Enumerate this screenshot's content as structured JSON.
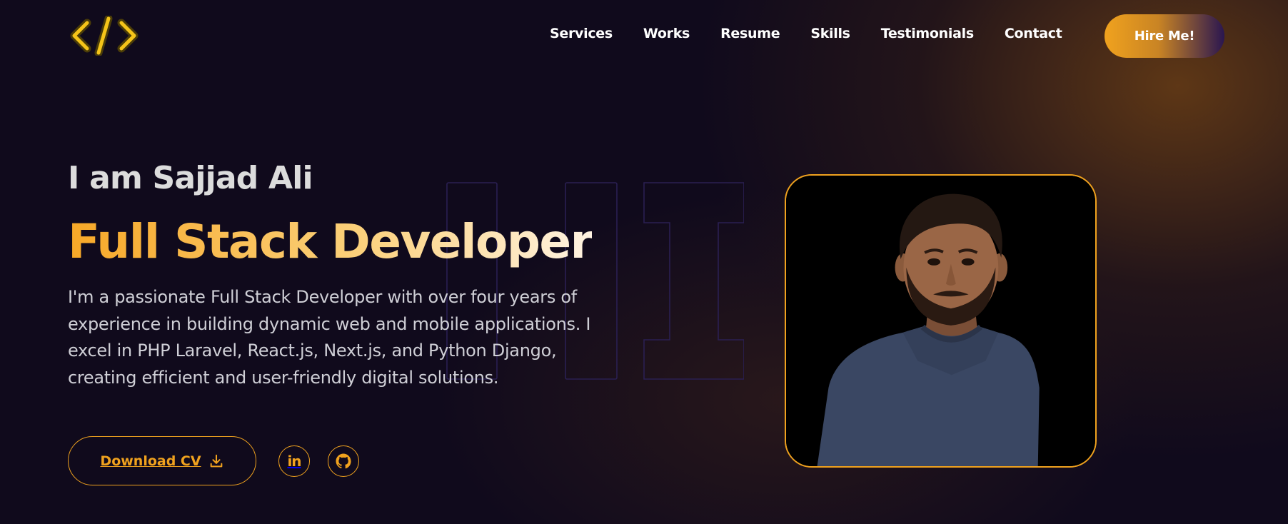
{
  "header": {
    "logo_icon": "code-brackets-icon",
    "nav": [
      "Services",
      "Works",
      "Resume",
      "Skills",
      "Testimonials",
      "Contact"
    ],
    "hire_label": "Hire Me!"
  },
  "hero": {
    "greeting": "I am Sajjad Ali",
    "role": "Full Stack Developer",
    "bio": "I'm a passionate Full Stack Developer with over four years of experience in building dynamic web and mobile applications. I excel in PHP Laravel, React.js, Next.js, and Python Django, creating efficient and user-friendly digital solutions.",
    "download_label": "Download CV",
    "download_icon": "download-icon",
    "social": [
      {
        "name": "linkedin",
        "icon": "linkedin-icon",
        "glyph": "in"
      },
      {
        "name": "github",
        "icon": "github-icon"
      }
    ],
    "portrait": "profile-photo"
  },
  "colors": {
    "accent": "#f0a21e",
    "background": "#100a1c",
    "hire_gradient_end": "#2a1650"
  }
}
